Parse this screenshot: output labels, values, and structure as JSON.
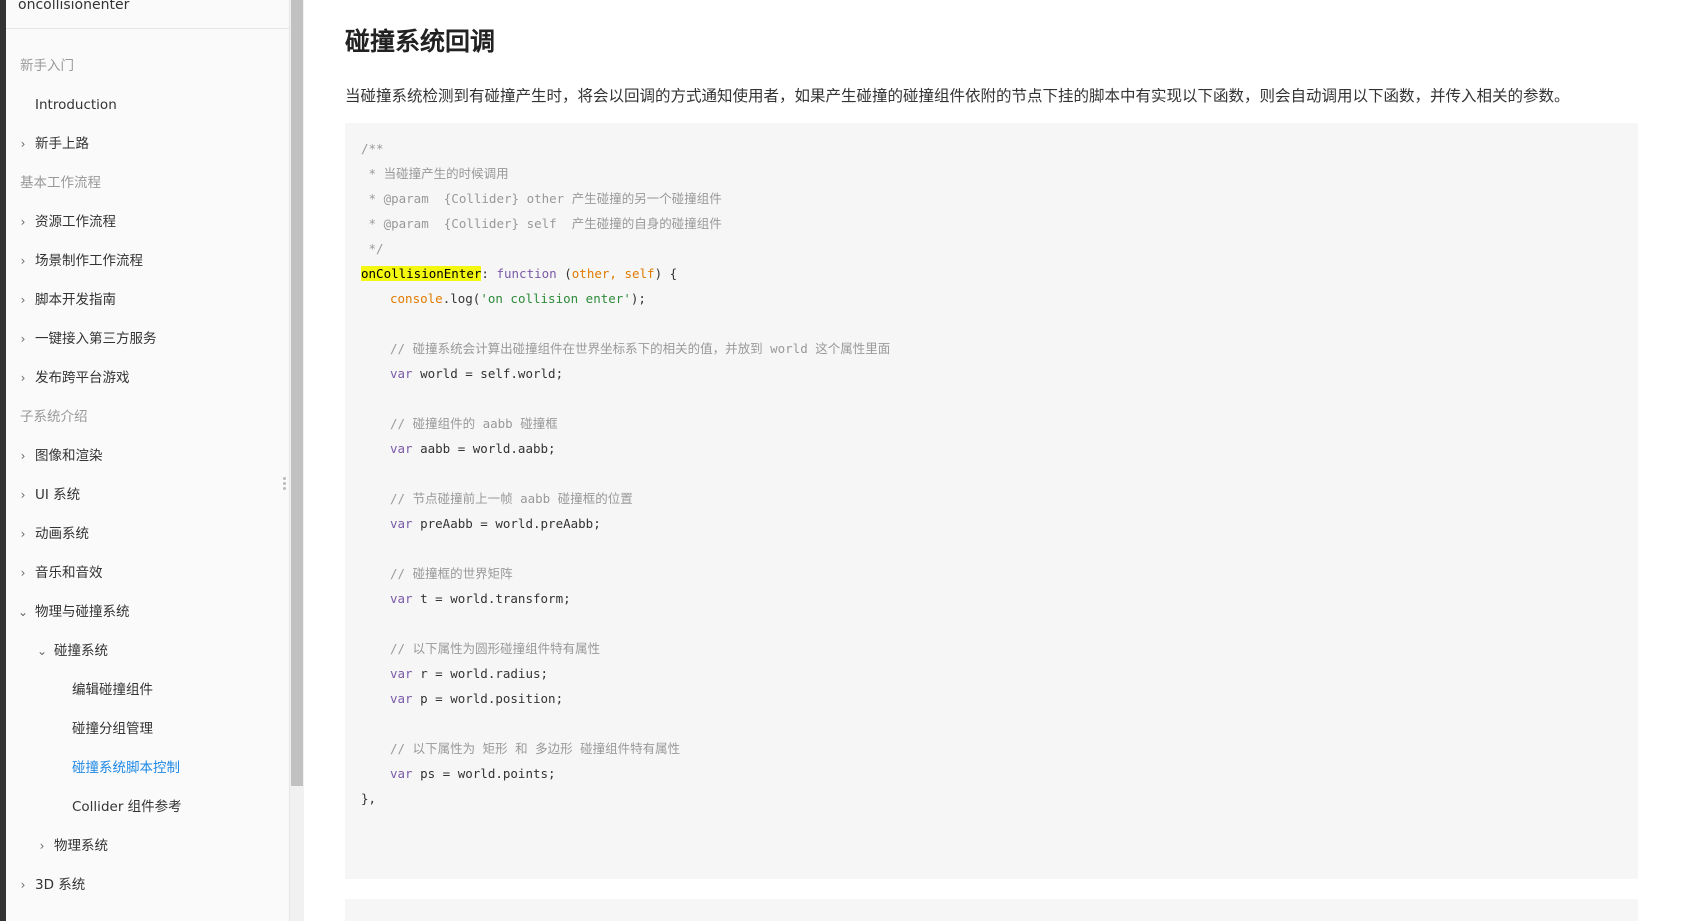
{
  "search": {
    "value": "oncollisionenter"
  },
  "sidebar": {
    "items": [
      {
        "kind": "section",
        "label": "新手入门"
      },
      {
        "kind": "item",
        "label": "Introduction",
        "level": 1,
        "chevron": ""
      },
      {
        "kind": "item",
        "label": "新手上路",
        "level": 1,
        "chevron": "›"
      },
      {
        "kind": "section",
        "label": "基本工作流程"
      },
      {
        "kind": "item",
        "label": "资源工作流程",
        "level": 1,
        "chevron": "›"
      },
      {
        "kind": "item",
        "label": "场景制作工作流程",
        "level": 1,
        "chevron": "›"
      },
      {
        "kind": "item",
        "label": "脚本开发指南",
        "level": 1,
        "chevron": "›"
      },
      {
        "kind": "item",
        "label": "一键接入第三方服务",
        "level": 1,
        "chevron": "›"
      },
      {
        "kind": "item",
        "label": "发布跨平台游戏",
        "level": 1,
        "chevron": "›"
      },
      {
        "kind": "section",
        "label": "子系统介绍"
      },
      {
        "kind": "item",
        "label": "图像和渲染",
        "level": 1,
        "chevron": "›"
      },
      {
        "kind": "item",
        "label": "UI 系统",
        "level": 1,
        "chevron": "›"
      },
      {
        "kind": "item",
        "label": "动画系统",
        "level": 1,
        "chevron": "›"
      },
      {
        "kind": "item",
        "label": "音乐和音效",
        "level": 1,
        "chevron": "›"
      },
      {
        "kind": "item",
        "label": "物理与碰撞系统",
        "level": 1,
        "chevron": "⌄"
      },
      {
        "kind": "item",
        "label": "碰撞系统",
        "level": 2,
        "chevron": "⌄"
      },
      {
        "kind": "item",
        "label": "编辑碰撞组件",
        "level": 3,
        "chevron": ""
      },
      {
        "kind": "item",
        "label": "碰撞分组管理",
        "level": 3,
        "chevron": ""
      },
      {
        "kind": "item",
        "label": "碰撞系统脚本控制",
        "level": 3,
        "chevron": "",
        "active": true
      },
      {
        "kind": "item",
        "label": "Collider 组件参考",
        "level": 3,
        "chevron": ""
      },
      {
        "kind": "item",
        "label": "物理系统",
        "level": 2,
        "chevron": "›"
      },
      {
        "kind": "item",
        "label": "3D 系统",
        "level": 1,
        "chevron": "›"
      }
    ]
  },
  "main": {
    "title": "碰撞系统回调",
    "intro": "当碰撞系统检测到有碰撞产生时，将会以回调的方式通知使用者，如果产生碰撞的碰撞组件依附的节点下挂的脚本中有实现以下函数，则会自动调用以下函数，并传入相关的参数。",
    "code": [
      {
        "line": 0,
        "indent": 0,
        "segments": [
          {
            "t": "/**",
            "c": "comment"
          }
        ]
      },
      {
        "line": 1,
        "indent": 0,
        "segments": [
          {
            "t": " * 当碰撞产生的时候调用",
            "c": "comment"
          }
        ]
      },
      {
        "line": 2,
        "indent": 0,
        "segments": [
          {
            "t": " * @param  {Collider} other 产生碰撞的另一个碰撞组件",
            "c": "comment"
          }
        ]
      },
      {
        "line": 3,
        "indent": 0,
        "segments": [
          {
            "t": " * @param  {Collider} self  产生碰撞的自身的碰撞组件",
            "c": "comment"
          }
        ]
      },
      {
        "line": 4,
        "indent": 0,
        "segments": [
          {
            "t": " */",
            "c": "comment"
          }
        ]
      },
      {
        "line": 5,
        "indent": 0,
        "segments": [
          {
            "t": "onCollisionEnter",
            "c": "hl"
          },
          {
            "t": ": ",
            "c": ""
          },
          {
            "t": "function",
            "c": "kw"
          },
          {
            "t": " (",
            "c": ""
          },
          {
            "t": "other, self",
            "c": "param"
          },
          {
            "t": ") {",
            "c": ""
          }
        ]
      },
      {
        "line": 6,
        "indent": 1,
        "segments": [
          {
            "t": "console",
            "c": "obj"
          },
          {
            "t": ".log(",
            "c": ""
          },
          {
            "t": "'on collision enter'",
            "c": "str"
          },
          {
            "t": ");",
            "c": ""
          }
        ]
      },
      {
        "line": 8,
        "indent": 1,
        "segments": [
          {
            "t": "// 碰撞系统会计算出碰撞组件在世界坐标系下的相关的值，并放到 world 这个属性里面",
            "c": "comment"
          }
        ]
      },
      {
        "line": 9,
        "indent": 1,
        "segments": [
          {
            "t": "var",
            "c": "kw"
          },
          {
            "t": " world = self.world;",
            "c": ""
          }
        ]
      },
      {
        "line": 11,
        "indent": 1,
        "segments": [
          {
            "t": "// 碰撞组件的 aabb 碰撞框",
            "c": "comment"
          }
        ]
      },
      {
        "line": 12,
        "indent": 1,
        "segments": [
          {
            "t": "var",
            "c": "kw"
          },
          {
            "t": " aabb = world.aabb;",
            "c": ""
          }
        ]
      },
      {
        "line": 14,
        "indent": 1,
        "segments": [
          {
            "t": "// 节点碰撞前上一帧 aabb 碰撞框的位置",
            "c": "comment"
          }
        ]
      },
      {
        "line": 15,
        "indent": 1,
        "segments": [
          {
            "t": "var",
            "c": "kw"
          },
          {
            "t": " preAabb = world.preAabb;",
            "c": ""
          }
        ]
      },
      {
        "line": 17,
        "indent": 1,
        "segments": [
          {
            "t": "// 碰撞框的世界矩阵",
            "c": "comment"
          }
        ]
      },
      {
        "line": 18,
        "indent": 1,
        "segments": [
          {
            "t": "var",
            "c": "kw"
          },
          {
            "t": " t = world.transform;",
            "c": ""
          }
        ]
      },
      {
        "line": 20,
        "indent": 1,
        "segments": [
          {
            "t": "// 以下属性为圆形碰撞组件特有属性",
            "c": "comment"
          }
        ]
      },
      {
        "line": 21,
        "indent": 1,
        "segments": [
          {
            "t": "var",
            "c": "kw"
          },
          {
            "t": " r = world.radius;",
            "c": ""
          }
        ]
      },
      {
        "line": 22,
        "indent": 1,
        "segments": [
          {
            "t": "var",
            "c": "kw"
          },
          {
            "t": " p = world.position;",
            "c": ""
          }
        ]
      },
      {
        "line": 24,
        "indent": 1,
        "segments": [
          {
            "t": "// 以下属性为 矩形 和 多边形 碰撞组件特有属性",
            "c": "comment"
          }
        ]
      },
      {
        "line": 25,
        "indent": 1,
        "segments": [
          {
            "t": "var",
            "c": "kw"
          },
          {
            "t": " ps = world.points;",
            "c": ""
          }
        ]
      },
      {
        "line": 26,
        "indent": 0,
        "segments": [
          {
            "t": "},",
            "c": ""
          }
        ]
      }
    ]
  }
}
